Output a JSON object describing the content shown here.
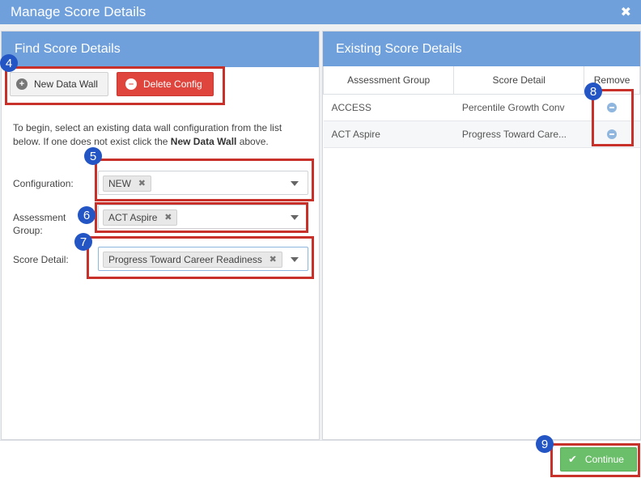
{
  "window": {
    "title": "Manage Score Details",
    "close_glyph": "✖"
  },
  "left_panel": {
    "title": "Find Score Details",
    "new_data_wall_label": "New Data Wall",
    "delete_config_label": "Delete Config",
    "intro_text_1": "To begin, select an existing data wall configuration from the list below. If one does not exist click the ",
    "intro_bold": "New Data Wall",
    "intro_text_2": " above.",
    "fields": {
      "configuration": {
        "label": "Configuration:",
        "value": "NEW"
      },
      "assessment_group": {
        "label": "Assessment Group:",
        "value": "ACT Aspire"
      },
      "score_detail": {
        "label": "Score Detail:",
        "value": "Progress Toward Career Readiness"
      }
    }
  },
  "right_panel": {
    "title": "Existing Score Details",
    "columns": [
      "Assessment Group",
      "Score Detail",
      "Remove"
    ],
    "rows": [
      {
        "assessment_group": "ACCESS",
        "score_detail": "Percentile Growth Conv"
      },
      {
        "assessment_group": "ACT Aspire",
        "score_detail": "Progress Toward Care..."
      }
    ]
  },
  "footer": {
    "continue_label": "Continue"
  },
  "annotations": [
    "4",
    "5",
    "6",
    "7",
    "8",
    "9"
  ],
  "colors": {
    "header": "#6fa0dc",
    "danger": "#e0453d",
    "success": "#6cbf6a",
    "highlight": "#c8302a",
    "badge": "#2455c4"
  },
  "icons": {
    "new_data_wall": "plus-circle-icon",
    "delete_config": "minus-circle-icon",
    "remove": "minus-circle-icon",
    "continue": "check-icon",
    "close": "close-icon"
  }
}
